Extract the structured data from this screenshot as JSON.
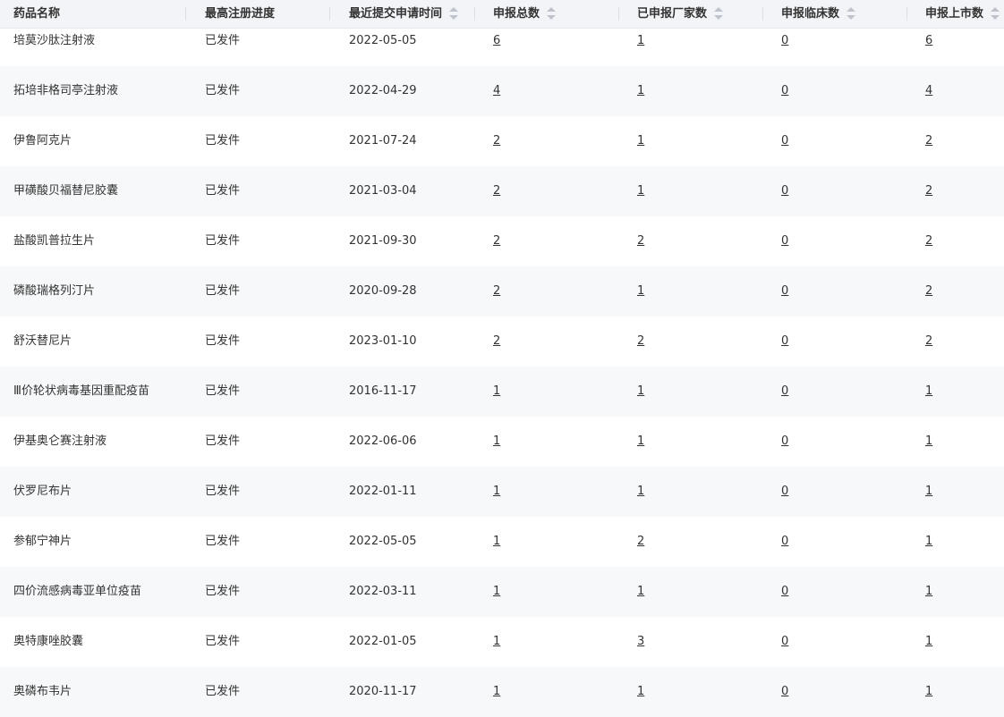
{
  "columns": [
    {
      "label": "药品名称",
      "sortable": false
    },
    {
      "label": "最高注册进度",
      "sortable": false
    },
    {
      "label": "最近提交申请时间",
      "sortable": true
    },
    {
      "label": "申报总数",
      "sortable": true
    },
    {
      "label": "已申报厂家数",
      "sortable": true
    },
    {
      "label": "申报临床数",
      "sortable": true
    },
    {
      "label": "申报上市数",
      "sortable": true
    }
  ],
  "rows": [
    {
      "name": "培莫沙肽注射液",
      "progress": "已发件",
      "date": "2022-05-05",
      "total": "6",
      "makers": "1",
      "clinical": "0",
      "market": "6"
    },
    {
      "name": "拓培非格司亭注射液",
      "progress": "已发件",
      "date": "2022-04-29",
      "total": "4",
      "makers": "1",
      "clinical": "0",
      "market": "4"
    },
    {
      "name": "伊鲁阿克片",
      "progress": "已发件",
      "date": "2021-07-24",
      "total": "2",
      "makers": "1",
      "clinical": "0",
      "market": "2"
    },
    {
      "name": "甲磺酸贝福替尼胶囊",
      "progress": "已发件",
      "date": "2021-03-04",
      "total": "2",
      "makers": "1",
      "clinical": "0",
      "market": "2"
    },
    {
      "name": "盐酸凯普拉生片",
      "progress": "已发件",
      "date": "2021-09-30",
      "total": "2",
      "makers": "2",
      "clinical": "0",
      "market": "2"
    },
    {
      "name": "磷酸瑞格列汀片",
      "progress": "已发件",
      "date": "2020-09-28",
      "total": "2",
      "makers": "1",
      "clinical": "0",
      "market": "2"
    },
    {
      "name": "舒沃替尼片",
      "progress": "已发件",
      "date": "2023-01-10",
      "total": "2",
      "makers": "2",
      "clinical": "0",
      "market": "2"
    },
    {
      "name": "Ⅲ价轮状病毒基因重配疫苗",
      "progress": "已发件",
      "date": "2016-11-17",
      "total": "1",
      "makers": "1",
      "clinical": "0",
      "market": "1"
    },
    {
      "name": "伊基奥仑赛注射液",
      "progress": "已发件",
      "date": "2022-06-06",
      "total": "1",
      "makers": "1",
      "clinical": "0",
      "market": "1"
    },
    {
      "name": "伏罗尼布片",
      "progress": "已发件",
      "date": "2022-01-11",
      "total": "1",
      "makers": "1",
      "clinical": "0",
      "market": "1"
    },
    {
      "name": "参郁宁神片",
      "progress": "已发件",
      "date": "2022-05-05",
      "total": "1",
      "makers": "2",
      "clinical": "0",
      "market": "1"
    },
    {
      "name": "四价流感病毒亚单位疫苗",
      "progress": "已发件",
      "date": "2022-03-11",
      "total": "1",
      "makers": "1",
      "clinical": "0",
      "market": "1"
    },
    {
      "name": "奥特康唑胶囊",
      "progress": "已发件",
      "date": "2022-01-05",
      "total": "1",
      "makers": "3",
      "clinical": "0",
      "market": "1"
    },
    {
      "name": "奥磷布韦片",
      "progress": "已发件",
      "date": "2020-11-17",
      "total": "1",
      "makers": "1",
      "clinical": "0",
      "market": "1"
    }
  ]
}
